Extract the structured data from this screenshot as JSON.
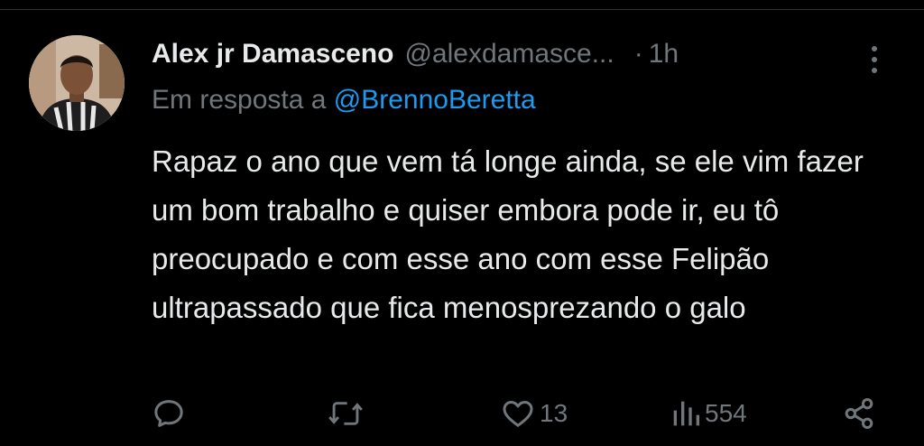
{
  "tweet": {
    "author_name": "Alex jr Damasceno",
    "author_handle": "@alexdamasce...",
    "separator": "·",
    "time": "1h",
    "reply_prefix": "Em resposta a",
    "reply_mention": "@BrennoBeretta",
    "text": "Rapaz o ano que vem tá longe ainda, se ele vim fazer um bom trabalho e quiser embora pode ir, eu tô preocupado e com esse ano com esse Felipão ultrapassado que fica menosprezando o galo"
  },
  "actions": {
    "reply_icon": "reply-icon",
    "retweet_icon": "retweet-icon",
    "like_icon": "heart-icon",
    "like_count": "13",
    "views_icon": "views-icon",
    "views_count": "554",
    "share_icon": "share-icon"
  },
  "colors": {
    "background": "#000000",
    "text_primary": "#e7e9ea",
    "text_secondary": "#71767b",
    "link": "#1d9bf0"
  }
}
